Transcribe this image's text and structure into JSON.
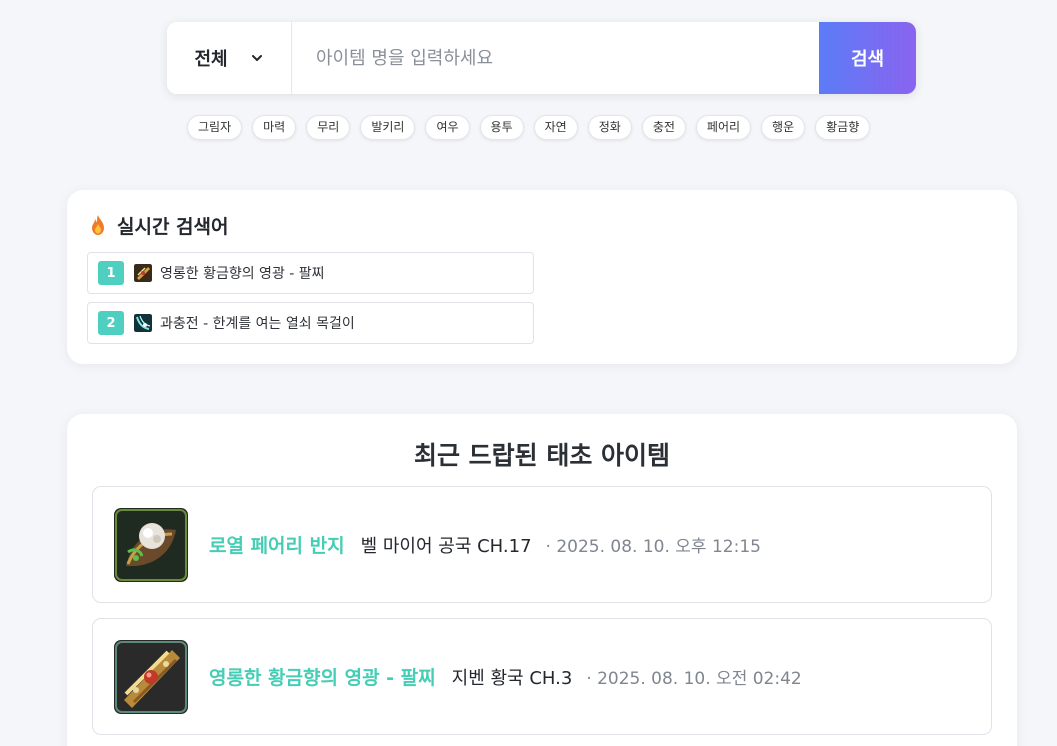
{
  "search": {
    "category": "전체",
    "placeholder": "아이템 명을 입력하세요",
    "button_label": "검색",
    "button_gradient": [
      "#5b7cf6",
      "#8a64f0"
    ]
  },
  "tags": [
    "그림자",
    "마력",
    "무리",
    "발키리",
    "여우",
    "용투",
    "자연",
    "정화",
    "충전",
    "페어리",
    "행운",
    "황금향"
  ],
  "realtime": {
    "icon": "fire-icon",
    "title": "실시간 검색어",
    "accent": "#4fcfc0",
    "items": [
      {
        "rank": "1",
        "name": "영롱한 황금향의 영광 - 팔찌",
        "icon": "bracelet-item-icon"
      },
      {
        "rank": "2",
        "name": "과충전 - 한계를 여는 열쇠 목걸이",
        "icon": "necklace-item-icon"
      }
    ]
  },
  "recent": {
    "title": "최근 드랍된 태초 아이템",
    "name_color": "#45cdb5",
    "items": [
      {
        "name": "로열 페어리 반지",
        "location": "벨 마이어 공국 CH.17",
        "time": "· 2025. 08. 10. 오후 12:15",
        "icon": "ring-item-icon"
      },
      {
        "name": "영롱한 황금향의 영광 - 팔찌",
        "location": "지벤 황국 CH.3",
        "time": "· 2025. 08. 10. 오전 02:42",
        "icon": "bracelet-item-icon"
      }
    ]
  }
}
